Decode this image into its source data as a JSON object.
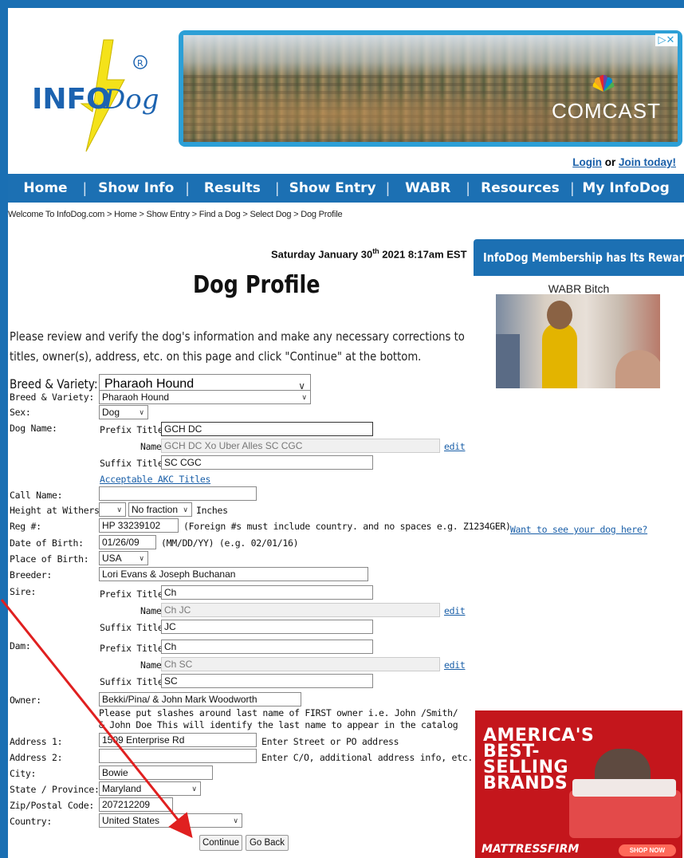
{
  "header": {
    "logo_text": "INFODog",
    "logo_mark": "®",
    "ad_brand": "COMCAST",
    "ad_corner": "▷✕",
    "login": "Login",
    "or": " or ",
    "join": "Join today!"
  },
  "nav": {
    "items": [
      "Home",
      "Show Info",
      "Results",
      "Show Entry",
      "WABR",
      "Resources",
      "My InfoDog"
    ],
    "sep": "|"
  },
  "breadcrumb": "Welcome To InfoDog.com > Home > Show Entry > Find a Dog > Select Dog > Dog Profile",
  "date": {
    "pre": "Saturday January 30",
    "sup": "th",
    "post": " 2021 8:17am EST"
  },
  "title": "Dog Profile",
  "intro": "Please review and verify the dog's information and make any necessary corrections to titles, owner(s), address, etc. on this page and click \"Continue\" at the bottom.",
  "form": {
    "breed_big_label": "Breed & Variety:",
    "breed_big_value": "Pharaoh Hound",
    "breed_label": "Breed & Variety:",
    "breed_value": "Pharaoh Hound",
    "sex_label": "Sex:",
    "sex_value": "Dog",
    "dog_name_label": "Dog Name:",
    "prefix_label": "Prefix Title(s):",
    "name_label": "Name:",
    "suffix_label": "Suffix Title(s):",
    "dog_prefix": "GCH DC",
    "dog_name": "GCH DC Xo Uber Alles SC CGC",
    "dog_suffix": "SC CGC",
    "edit": "edit",
    "akc_titles": "Acceptable AKC Titles",
    "call_name_label": "Call Name:",
    "call_name": "",
    "height_label": "Height at Withers:",
    "height_inches": "",
    "height_fraction": "No fraction",
    "inches": "Inches",
    "reg_label": "Reg #:",
    "reg_value": "HP 33239102",
    "reg_note": "(Foreign #s must include country. and no spaces e.g. Z1234GER)",
    "dob_label": "Date of Birth:",
    "dob_value": "01/26/09",
    "dob_note": "(MM/DD/YY) (e.g. 02/01/16)",
    "pob_label": "Place of Birth:",
    "pob_value": "USA",
    "breeder_label": "Breeder:",
    "breeder_value": "Lori Evans & Joseph Buchanan",
    "sire_label": "Sire:",
    "sire_prefix": "Ch",
    "sire_name": "Ch JC",
    "sire_suffix": "JC",
    "dam_label": "Dam:",
    "dam_prefix": "Ch",
    "dam_name": "Ch SC",
    "dam_suffix": "SC",
    "owner_label": "Owner:",
    "owner_value": "Bekki/Pina/ & John Mark Woodworth",
    "owner_note": "Please put slashes around last name of FIRST owner i.e. John /Smith/ & John Doe This will identify the last name to appear in the catalog index.",
    "addr1_label": "Address 1:",
    "addr1_value": "1509 Enterprise Rd",
    "addr1_note": "Enter Street or PO address",
    "addr2_label": "Address 2:",
    "addr2_value": "",
    "addr2_note": "Enter C/O, additional address info, etc.",
    "city_label": "City:",
    "city_value": "Bowie",
    "state_label": "State / Province:",
    "state_value": "Maryland",
    "zip_label": "Zip/Postal Code:",
    "zip_value": "207212209",
    "country_label": "Country:",
    "country_value": "United States",
    "continue": "Continue",
    "go_back": "Go Back"
  },
  "sidebar": {
    "heading": "InfoDog Membership has Its Rewards",
    "photo_caption": "WABR Bitch",
    "want": "Want to see your dog here?",
    "ad_lines": [
      "AMERICA'S",
      "BEST-",
      "SELLING",
      "BRANDS"
    ],
    "ad_brand": "MATTRESSFIRM",
    "ad_shop": "SHOP NOW"
  },
  "colors": {
    "nav": "#1c70b3",
    "link": "#1a5fa8",
    "arrow": "#e02020",
    "frame": "#1a6fb3"
  }
}
